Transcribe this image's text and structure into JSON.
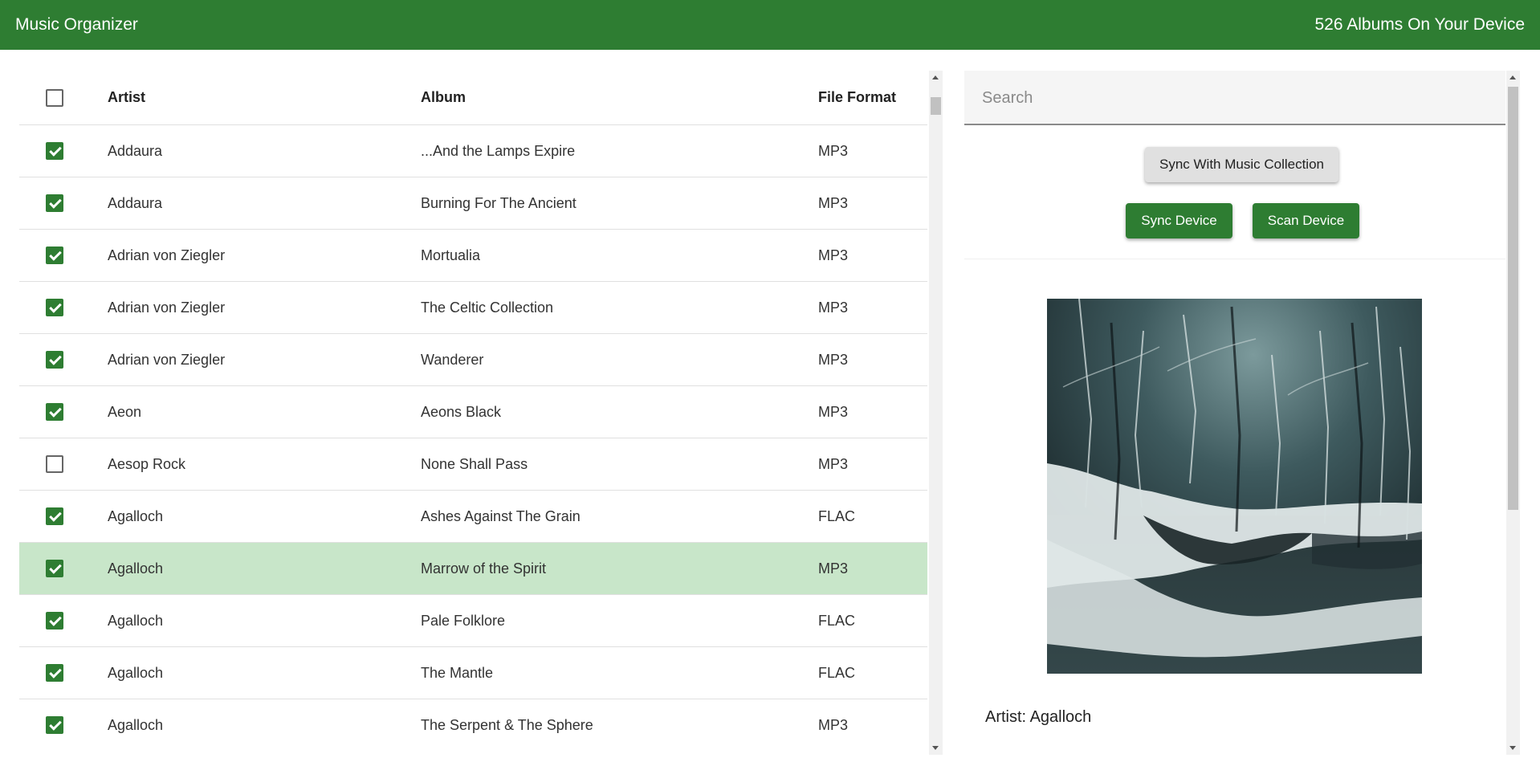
{
  "appbar": {
    "title": "Music Organizer",
    "album_count": "526 Albums On Your Device",
    "color": "#2e7d32"
  },
  "table": {
    "columns": [
      "Artist",
      "Album",
      "File Format"
    ],
    "header_checked": false,
    "rows": [
      {
        "checked": true,
        "artist": "Addaura",
        "album": "...And the Lamps Expire",
        "format": "MP3",
        "selected": false
      },
      {
        "checked": true,
        "artist": "Addaura",
        "album": "Burning For The Ancient",
        "format": "MP3",
        "selected": false
      },
      {
        "checked": true,
        "artist": "Adrian von Ziegler",
        "album": "Mortualia",
        "format": "MP3",
        "selected": false
      },
      {
        "checked": true,
        "artist": "Adrian von Ziegler",
        "album": "The Celtic Collection",
        "format": "MP3",
        "selected": false
      },
      {
        "checked": true,
        "artist": "Adrian von Ziegler",
        "album": "Wanderer",
        "format": "MP3",
        "selected": false
      },
      {
        "checked": true,
        "artist": "Aeon",
        "album": "Aeons Black",
        "format": "MP3",
        "selected": false
      },
      {
        "checked": false,
        "artist": "Aesop Rock",
        "album": "None Shall Pass",
        "format": "MP3",
        "selected": false
      },
      {
        "checked": true,
        "artist": "Agalloch",
        "album": "Ashes Against The Grain",
        "format": "FLAC",
        "selected": false
      },
      {
        "checked": true,
        "artist": "Agalloch",
        "album": "Marrow of the Spirit",
        "format": "MP3",
        "selected": true
      },
      {
        "checked": true,
        "artist": "Agalloch",
        "album": "Pale Folklore",
        "format": "FLAC",
        "selected": false
      },
      {
        "checked": true,
        "artist": "Agalloch",
        "album": "The Mantle",
        "format": "FLAC",
        "selected": false
      },
      {
        "checked": true,
        "artist": "Agalloch",
        "album": "The Serpent & The Sphere",
        "format": "MP3",
        "selected": false
      }
    ],
    "selected_row_color": "#c8e6c9"
  },
  "sidebar": {
    "search_placeholder": "Search",
    "sync_collection_label": "Sync With Music Collection",
    "sync_device_label": "Sync Device",
    "scan_device_label": "Scan Device",
    "album_art_icon": "album-cover-image",
    "artist_line": "Artist: Agalloch"
  }
}
